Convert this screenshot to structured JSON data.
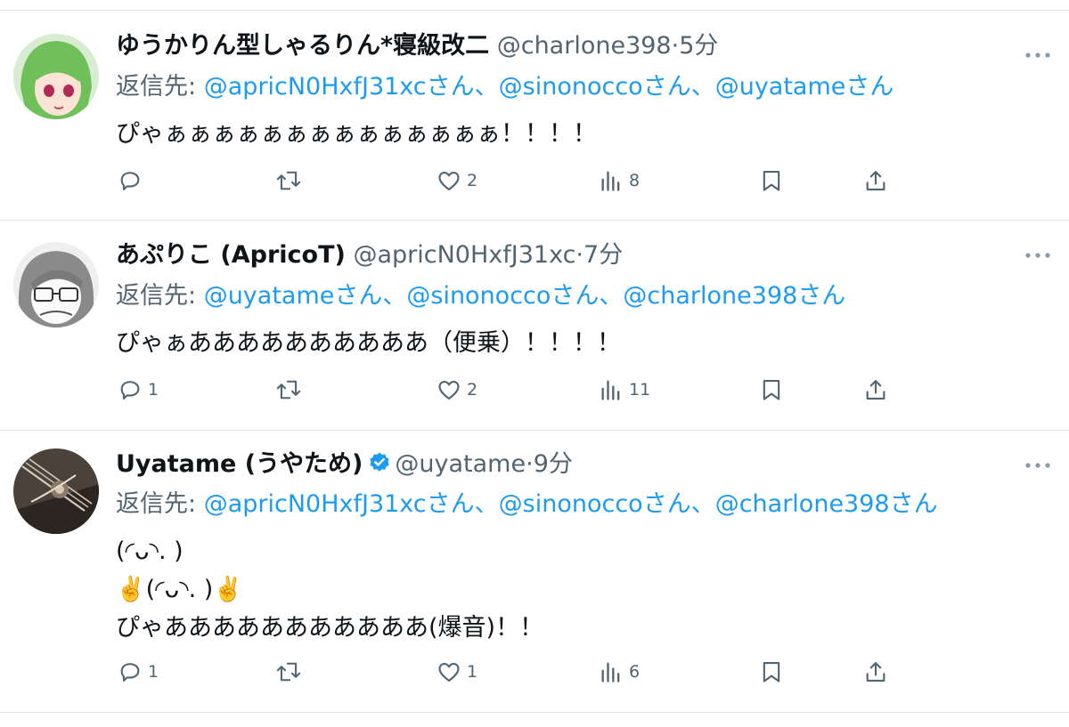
{
  "tweets": [
    {
      "name": "ゆうかりん型しゃるりん*寝級改二",
      "handle": "@charlone398",
      "sep": "·",
      "time": "5分",
      "reply_prefix": "返信先: ",
      "reply_to": [
        {
          "mention": "@apricN0HxfJ31xc",
          "suffix": "さん、"
        },
        {
          "mention": "@sinonocco",
          "suffix": "さん、"
        },
        {
          "mention": "@uyatame",
          "suffix": "さん"
        }
      ],
      "lines": [
        "ぴゃぁぁぁぁぁぁぁぁぁぁぁぁぁぁ！！！！"
      ],
      "counts": {
        "reply": "",
        "retweet": "",
        "like": "2",
        "views": "8"
      },
      "avatar_colors": {
        "bg": "#bfe0b5",
        "hair": "#6fbf5a",
        "face": "#fbe3d6"
      }
    },
    {
      "name": "あぷりこ (ApricoT)",
      "handle": "@apricN0HxfJ31xc",
      "sep": "·",
      "time": "7分",
      "reply_prefix": "返信先: ",
      "reply_to": [
        {
          "mention": "@uyatame",
          "suffix": "さん、"
        },
        {
          "mention": "@sinonocco",
          "suffix": "さん、"
        },
        {
          "mention": "@charlone398",
          "suffix": "さん"
        }
      ],
      "lines": [
        "ぴゃぁああああああああああ（便乗）！！！！"
      ],
      "counts": {
        "reply": "1",
        "retweet": "",
        "like": "2",
        "views": "11"
      },
      "avatar_colors": {
        "bg": "#ececec",
        "hair": "#6b6b6b",
        "face": "#f7f7f7"
      }
    },
    {
      "name": "Uyatame (うやため)",
      "handle": "@uyatame",
      "sep": "·",
      "time": "9分",
      "verified": true,
      "reply_prefix": "返信先: ",
      "reply_to": [
        {
          "mention": "@apricN0HxfJ31xc",
          "suffix": "さん、"
        },
        {
          "mention": "@sinonocco",
          "suffix": "さん、"
        },
        {
          "mention": "@charlone398",
          "suffix": "さん"
        }
      ],
      "lines": [
        "(◜ᴗ◝. )",
        "✌️(◜ᴗ◝. )✌️",
        "ぴゃあああああああああああ(爆音)！！"
      ],
      "counts": {
        "reply": "1",
        "retweet": "",
        "like": "1",
        "views": "6"
      },
      "avatar_colors": {
        "bg": "#3f3a36",
        "hair": "#c9bfae",
        "face": "#7a6a5c"
      }
    }
  ],
  "colors": {
    "text": "#0f1419",
    "secondary": "#536471",
    "link": "#1d9bf0",
    "verified": "#1d9bf0",
    "divider": "#e1e6ea"
  }
}
